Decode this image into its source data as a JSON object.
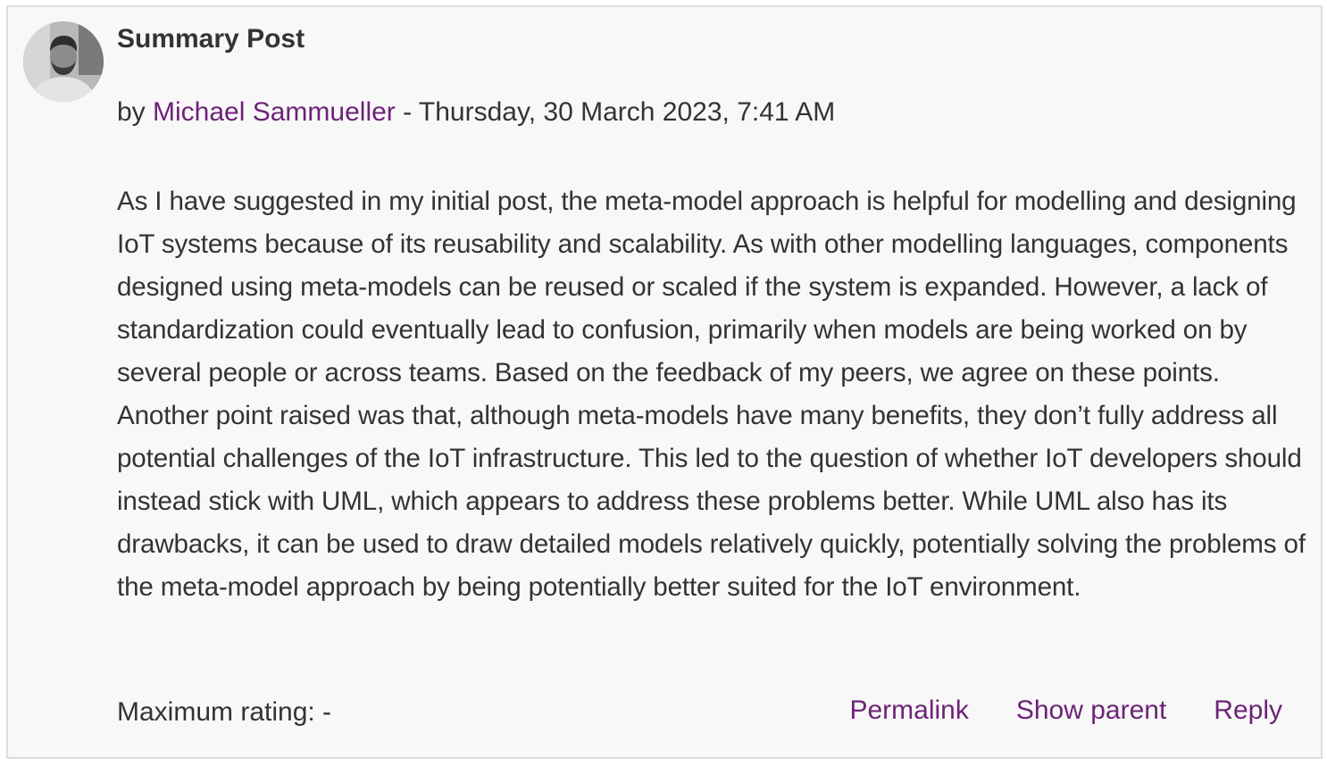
{
  "post": {
    "title": "Summary Post",
    "byline_prefix": "by ",
    "author": "Michael Sammueller",
    "byline_separator": " - ",
    "date": "Thursday, 30 March 2023, 7:41 AM",
    "body": "As I have suggested in my initial post, the meta-model approach is helpful for modelling and designing IoT systems because of its reusability and scalability. As with other modelling languages, components designed using meta-models can be reused or scaled if the system is expanded. However, a lack of standardization could eventually lead to confusion, primarily when models are being worked on by several people or across teams. Based on the feedback of my peers, we agree on these points. Another point raised was that, although meta-models have many benefits, they don’t fully address all potential challenges of the IoT infrastructure. This led to the question of whether IoT developers should instead stick with UML, which appears to address these problems better. While UML also has its drawbacks, it can be used to draw detailed models relatively quickly, potentially solving the problems of the meta-model approach by being potentially better suited for the IoT environment.",
    "rating_label": "Maximum rating: -"
  },
  "actions": {
    "permalink": "Permalink",
    "show_parent": "Show parent",
    "reply": "Reply"
  },
  "colors": {
    "link": "#6d2377",
    "text": "#333333",
    "card_background": "#f8f8f8",
    "card_border": "#dedede"
  }
}
